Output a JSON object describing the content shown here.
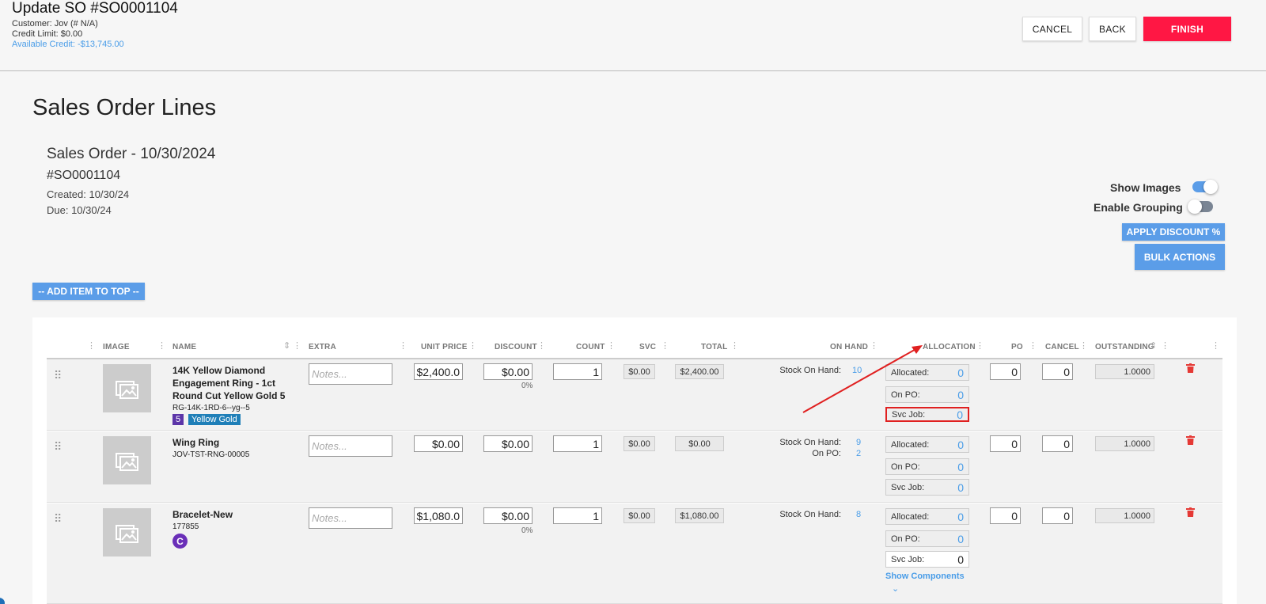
{
  "header": {
    "title": "Update SO #SO0001104",
    "customer": "Customer: Jov (# N/A)",
    "credit_limit": "Credit Limit: $0.00",
    "available_credit": "Available Credit: -$13,745.00",
    "cancel": "CANCEL",
    "back": "BACK",
    "finish": "FINISH"
  },
  "page": {
    "title": "Sales Order Lines",
    "so_title": "Sales Order - 10/30/2024",
    "so_number": "#SO0001104",
    "created": "Created: 10/30/24",
    "due": "Due: 10/30/24"
  },
  "toggles": {
    "show_images": "Show Images",
    "show_images_on": true,
    "enable_grouping": "Enable Grouping",
    "enable_grouping_on": false
  },
  "buttons": {
    "apply_discount": "APPLY DISCOUNT %",
    "bulk_actions": "BULK ACTIONS",
    "add_item_top": "-- ADD ITEM TO TOP --"
  },
  "columns": [
    "IMAGE",
    "NAME",
    "EXTRA",
    "UNIT PRICE",
    "DISCOUNT",
    "COUNT",
    "SVC",
    "TOTAL",
    "ON HAND",
    "ALLOCATION",
    "PO",
    "CANCEL",
    "OUTSTANDING"
  ],
  "rows": [
    {
      "name1": "14K Yellow Diamond",
      "name2": "Engagement Ring - 1ct",
      "name3": "Round Cut Yellow Gold 5",
      "sku": "RG-14K-1RD-6--yg--5",
      "badge_num": "5",
      "badge_text": "Yellow Gold",
      "notes_placeholder": "Notes...",
      "unit_price": "$2,400.0",
      "discount": "$0.00",
      "discount_pct": "0%",
      "count": "1",
      "svc": "$0.00",
      "total": "$2,400.00",
      "soh_label": "Stock On Hand:",
      "soh": "10",
      "allocated_label": "Allocated:",
      "allocated": "0",
      "onpo_label": "On PO:",
      "onpo": "0",
      "svcjob_label": "Svc Job:",
      "svcjob": "0",
      "po": "0",
      "cancel": "0",
      "outstanding": "1.0000"
    },
    {
      "name1": "Wing Ring",
      "sku": "JOV-TST-RNG-00005",
      "notes_placeholder": "Notes...",
      "unit_price": "$0.00",
      "discount": "$0.00",
      "count": "1",
      "svc": "$0.00",
      "total": "$0.00",
      "soh_label": "Stock On Hand:",
      "soh": "9",
      "onpo_h_label": "On PO:",
      "onpo_h": "2",
      "allocated_label": "Allocated:",
      "allocated": "0",
      "onpo_label": "On PO:",
      "onpo": "0",
      "svcjob_label": "Svc Job:",
      "svcjob": "0",
      "po": "0",
      "cancel": "0",
      "outstanding": "1.0000"
    },
    {
      "name1": "Bracelet-New",
      "sku": "177855",
      "badge_c": "C",
      "notes_placeholder": "Notes...",
      "unit_price": "$1,080.0",
      "discount": "$0.00",
      "discount_pct": "0%",
      "count": "1",
      "svc": "$0.00",
      "total": "$1,080.00",
      "soh_label": "Stock On Hand:",
      "soh": "8",
      "allocated_label": "Allocated:",
      "allocated": "0",
      "onpo_label": "On PO:",
      "onpo": "0",
      "svcjob_label": "Svc Job:",
      "svcjob": "0",
      "po": "0",
      "cancel": "0",
      "outstanding": "1.0000",
      "show_components": "Show Components"
    }
  ]
}
